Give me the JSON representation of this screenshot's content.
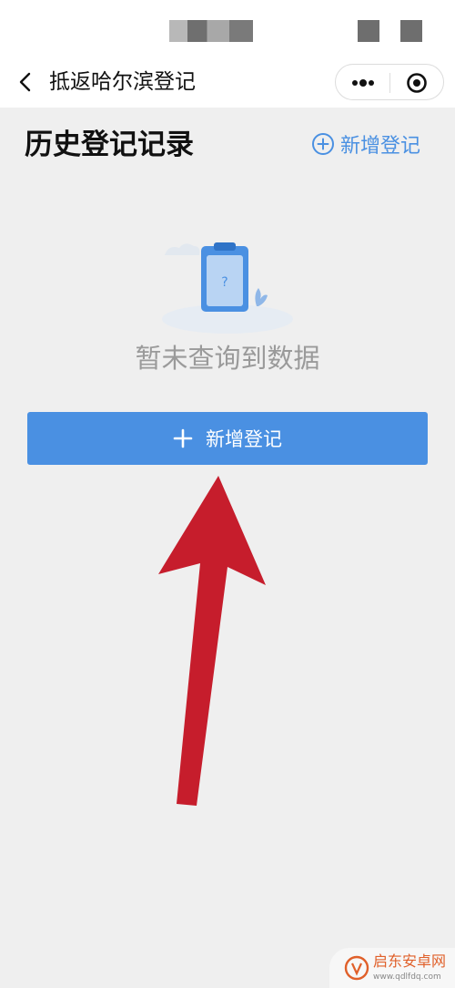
{
  "nav": {
    "title": "抵返哈尔滨登记"
  },
  "page": {
    "heading": "历史登记记录",
    "add_link_label": "新增登记",
    "empty_text": "暂未查询到数据",
    "add_button_label": "新增登记"
  },
  "watermark": {
    "name": "启东安卓网",
    "url": "www.qdlfdq.com"
  },
  "colors": {
    "accent": "#4a90e2",
    "background": "#efefef",
    "arrow": "#c61d2c"
  }
}
